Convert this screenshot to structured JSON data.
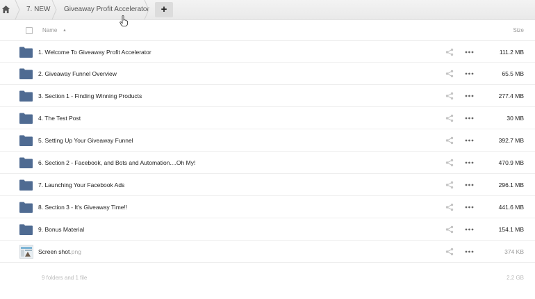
{
  "breadcrumb": {
    "items": [
      {
        "label": "7. NEW"
      },
      {
        "label": "Giveaway Profit Accelerator"
      }
    ],
    "add_button": "+"
  },
  "header": {
    "name_label": "Name",
    "sort_indicator": "▲",
    "size_label": "Size"
  },
  "rows": [
    {
      "name": "1. Welcome To Giveaway Profit Accelerator",
      "size": "111.2 MB",
      "icon": "folder-icon"
    },
    {
      "name": "2. Giveaway Funnel Overview",
      "size": "65.5 MB",
      "icon": "folder-icon"
    },
    {
      "name": "3. Section 1 - Finding Winning Products",
      "size": "277.4 MB",
      "icon": "folder-icon"
    },
    {
      "name": "4. The Test Post",
      "size": "30 MB",
      "icon": "folder-icon"
    },
    {
      "name": "5. Setting Up Your Giveaway Funnel",
      "size": "392.7 MB",
      "icon": "folder-icon"
    },
    {
      "name": "6. Section 2 - Facebook, and Bots and Automation....Oh My!",
      "size": "470.9 MB",
      "icon": "folder-icon"
    },
    {
      "name": "7. Launching Your Facebook Ads",
      "size": "296.1 MB",
      "icon": "folder-icon"
    },
    {
      "name": "8. Section 3 - It's Giveaway Time!!",
      "size": "441.6 MB",
      "icon": "folder-icon"
    },
    {
      "name": "9. Bonus Material",
      "size": "154.1 MB",
      "icon": "folder-icon"
    }
  ],
  "file_row": {
    "name": "Screen shot",
    "ext": ".png",
    "size": "374 KB",
    "icon": "image-thumbnail-icon"
  },
  "footer": {
    "summary": "9 folders and 1 file",
    "total": "2.2 GB"
  },
  "colors": {
    "folder": "#4f6b92",
    "crumb_bar": "#efefef",
    "add_button_bg": "#dcdcdc"
  }
}
